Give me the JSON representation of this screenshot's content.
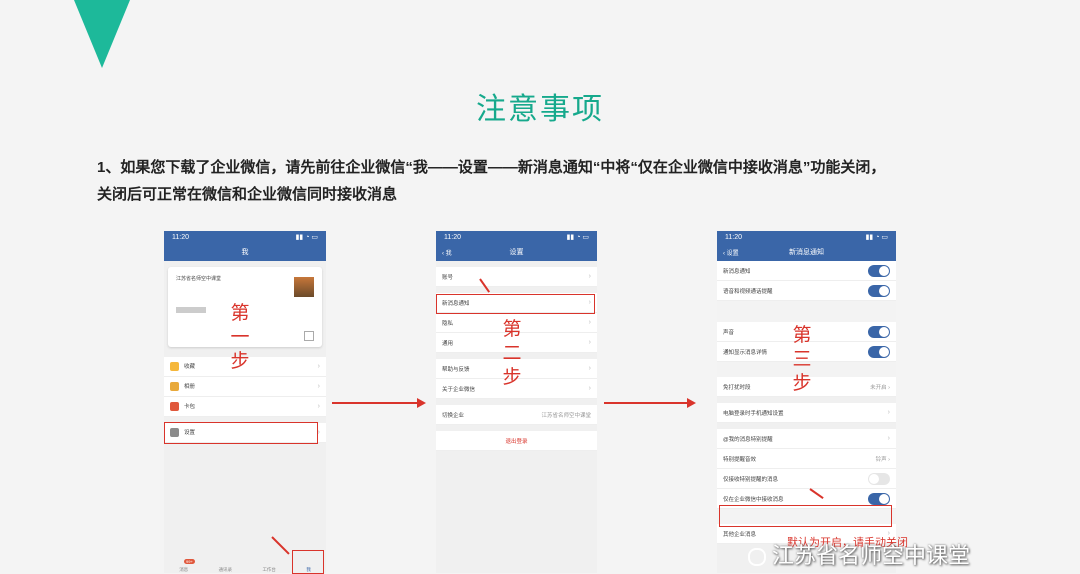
{
  "title": "注意事项",
  "instruction_line1": "1、如果您下载了企业微信，请先前往企业微信“我——设置——新消息通知“中将“仅在企业微信中接收消息”功能关闭，",
  "instruction_line2": "关闭后可正常在微信和企业微信同时接收消息",
  "colors": {
    "accent": "#1db99a",
    "brand": "#3a66a8",
    "highlight": "#d9342b"
  },
  "phone1": {
    "time": "11:20",
    "nav_title": "我",
    "company": "江苏省名师空中课堂",
    "items": [
      "收藏",
      "相册",
      "卡包"
    ],
    "settings": "设置",
    "tabs": [
      "消息",
      "通讯录",
      "工作台",
      "我"
    ],
    "badge": "99+"
  },
  "phone2": {
    "time": "11:20",
    "back": "我",
    "nav_title": "设置",
    "rows1": [
      "账号"
    ],
    "highlight_row": "新消息通知",
    "rows2": [
      "隐私",
      "通用"
    ],
    "rows3": [
      "帮助与反馈",
      "关于企业微信"
    ],
    "switch_label": "切换企业",
    "switch_value": "江苏省名师空中课堂",
    "logout": "退出登录"
  },
  "phone3": {
    "time": "11:20",
    "back": "设置",
    "nav_title": "新消息通知",
    "r1": "新消息通知",
    "r2": "语音和视频通话提醒",
    "r3": "声音",
    "r4": "通知显示消息详情",
    "r5": "免打扰时段",
    "r5v": "未开启",
    "r6": "电脑登录时手机通知设置",
    "r7": "@我的消息特别提醒",
    "r8": "特别提醒音效",
    "r8v": "铃声",
    "r9": "仅接收特别提醒的消息",
    "hl": "仅在企业微信中接收消息",
    "r10": "其他企业消息"
  },
  "steps": {
    "s1": [
      "第",
      "一",
      "步"
    ],
    "s2": [
      "第",
      "二",
      "步"
    ],
    "s3": [
      "第",
      "三",
      "步"
    ]
  },
  "note": "默认为开启，请手动关闭",
  "footer": "江苏省名师空中课堂"
}
